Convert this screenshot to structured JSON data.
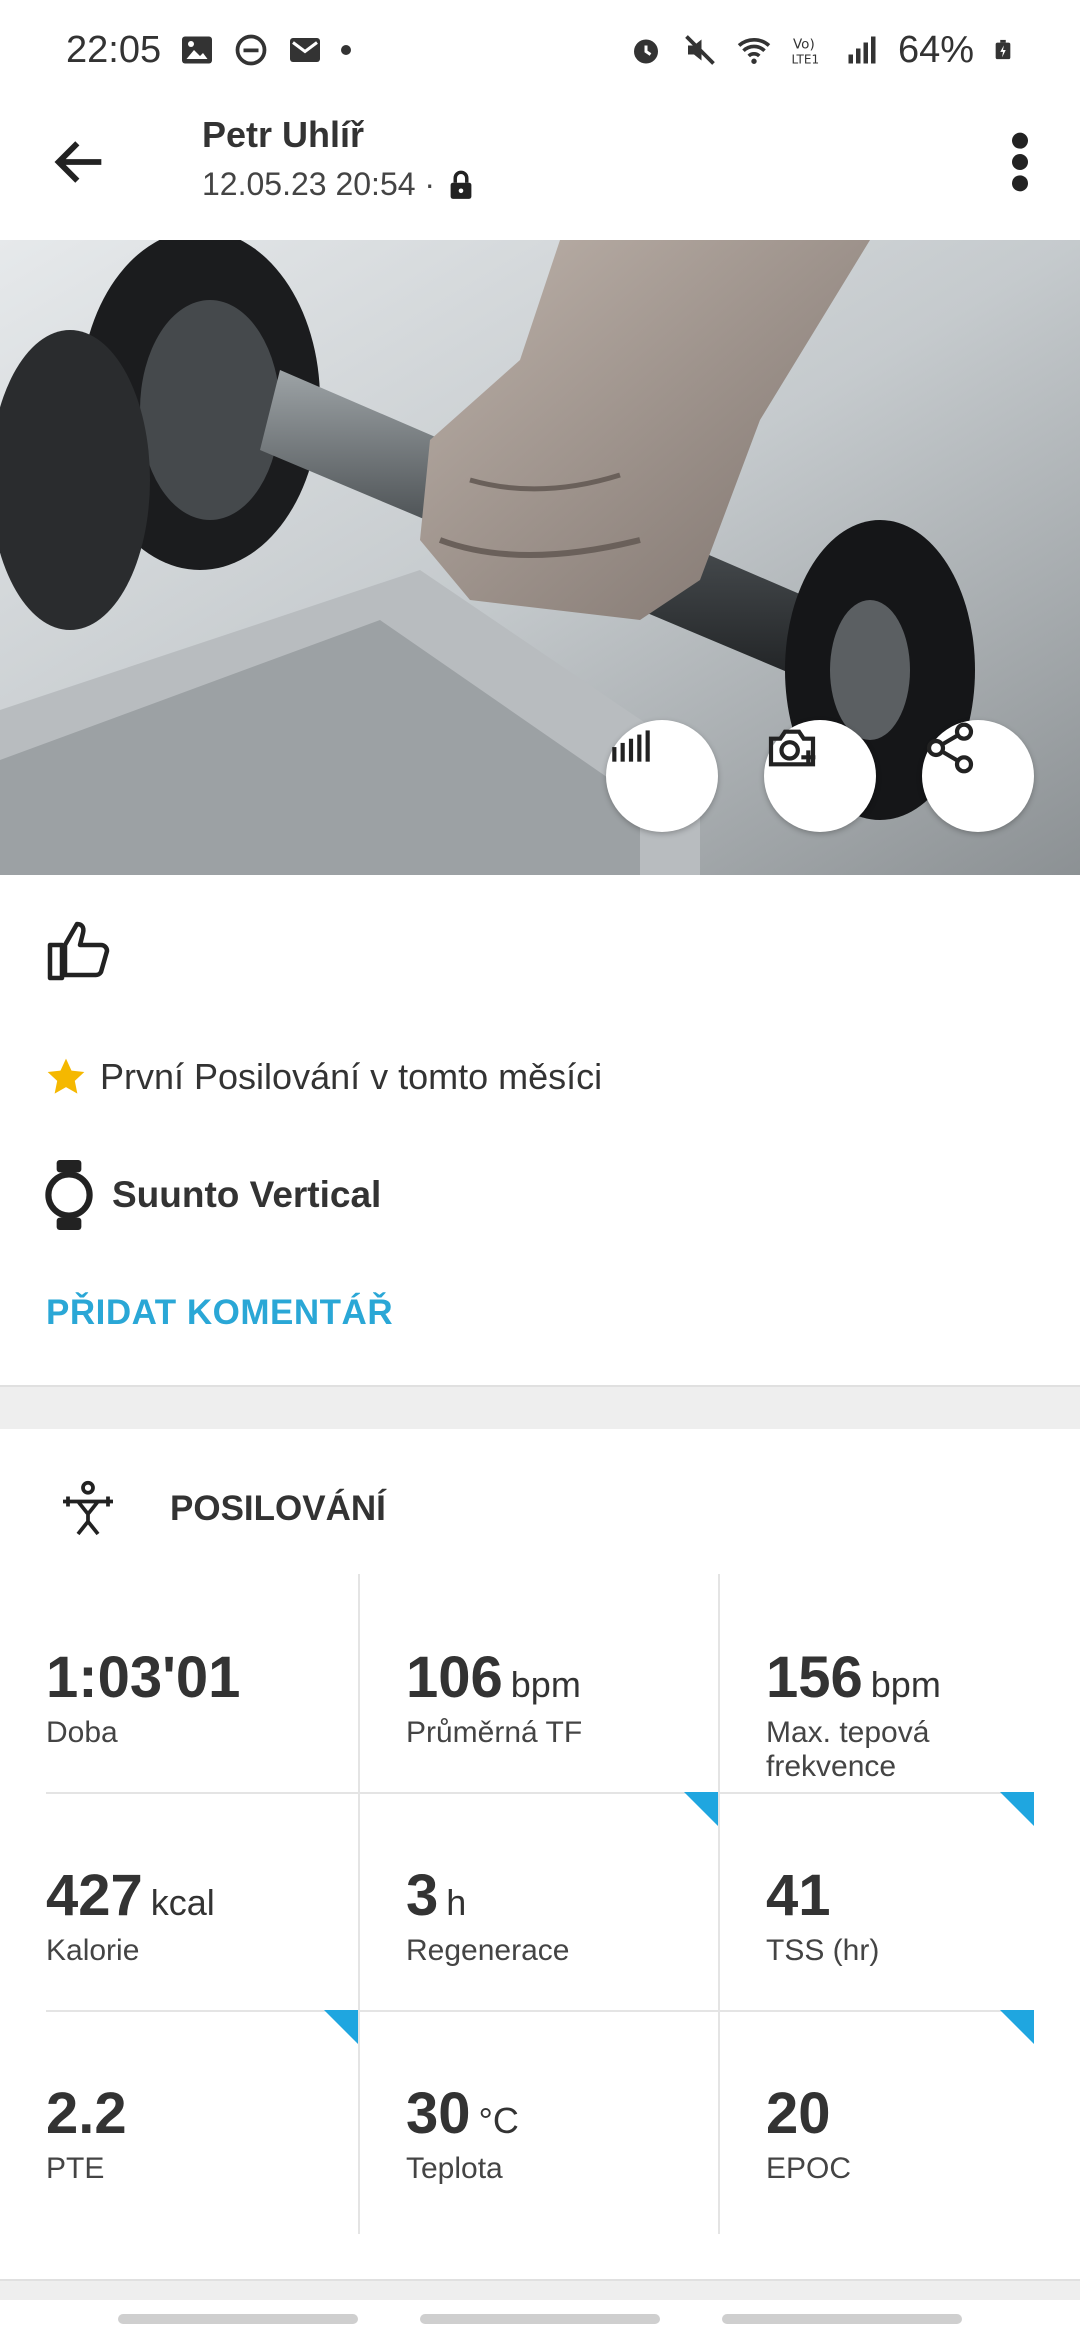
{
  "status_bar": {
    "time": "22:05",
    "battery": "64%"
  },
  "header": {
    "user_name": "Petr Uhlíř",
    "datetime": "12.05.23 20:54 ·"
  },
  "info": {
    "achievement": "První Posilování v tomto měsíci",
    "device": "Suunto Vertical",
    "add_comment": "PŘIDAT KOMENTÁŘ"
  },
  "activity": {
    "title": "POSILOVÁNÍ"
  },
  "stats": [
    {
      "value": "1:03'01",
      "unit": "",
      "label": "Doba"
    },
    {
      "value": "106",
      "unit": "bpm",
      "label": "Průměrná TF"
    },
    {
      "value": "156",
      "unit": "bpm",
      "label": "Max. tepová frekvence"
    },
    {
      "value": "427",
      "unit": "kcal",
      "label": "Kalorie"
    },
    {
      "value": "3",
      "unit": "h",
      "label": "Regenerace"
    },
    {
      "value": "41",
      "unit": "",
      "label": "TSS (hr)"
    },
    {
      "value": "2.2",
      "unit": "",
      "label": "PTE"
    },
    {
      "value": "30",
      "unit": "°C",
      "label": "Teplota"
    },
    {
      "value": "20",
      "unit": "",
      "label": "EPOC"
    }
  ],
  "colors": {
    "accent": "#2aa7d6",
    "corner_marker": "#1fa6e0",
    "star": "#f5b800"
  },
  "icons": [
    "back-arrow-icon",
    "more-vert-icon",
    "lock-icon",
    "analysis-icon",
    "add-photo-icon",
    "share-icon",
    "thumbs-up-icon",
    "star-icon",
    "watch-icon",
    "weightlifting-icon"
  ]
}
